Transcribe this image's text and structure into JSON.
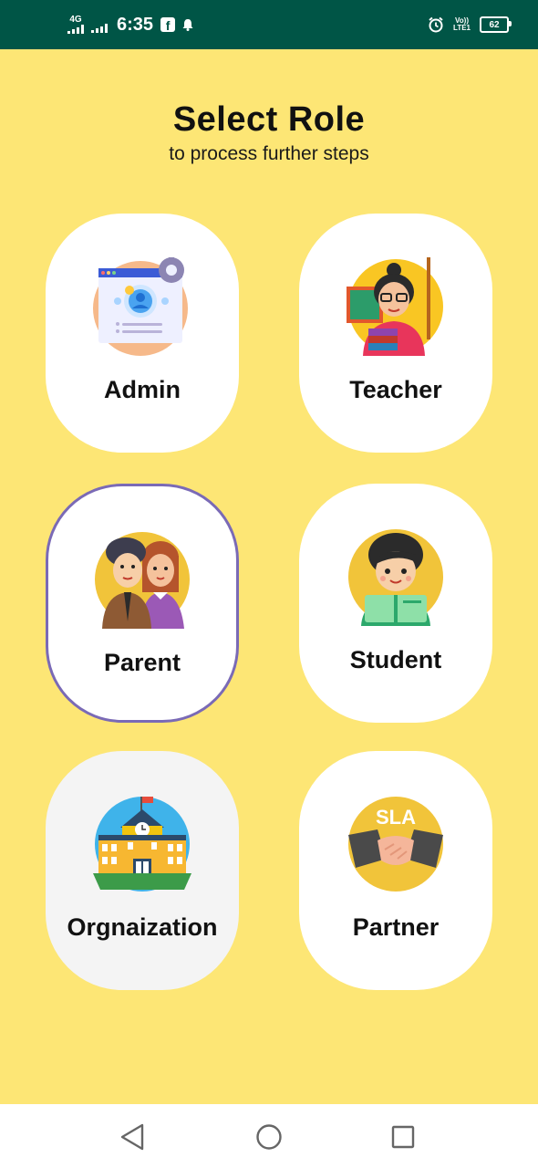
{
  "status_bar": {
    "network": "4G",
    "time": "6:35",
    "volte_top": "Vo))",
    "volte_bottom": "LTE1",
    "battery": "62",
    "icons": [
      "signal-icon",
      "signal-icon",
      "facebook-icon",
      "notification-bell-icon",
      "alarm-icon",
      "volte-icon",
      "battery-icon"
    ]
  },
  "header": {
    "title": "Select Role",
    "subtitle": "to process further steps"
  },
  "roles": [
    {
      "label": "Admin",
      "icon": "admin-profile-icon"
    },
    {
      "label": "Teacher",
      "icon": "teacher-icon"
    },
    {
      "label": "Parent",
      "icon": "parents-icon",
      "selected": true
    },
    {
      "label": "Student",
      "icon": "student-icon"
    },
    {
      "label": "Orgnaization",
      "icon": "school-building-icon"
    },
    {
      "label": "Partner",
      "icon": "handshake-icon",
      "badge": "SLA"
    }
  ],
  "nav": {
    "icons": [
      "back-triangle-icon",
      "home-circle-icon",
      "recents-square-icon"
    ]
  },
  "colors": {
    "background": "#fde675",
    "status_bar": "#005546",
    "selected_border": "#7a6ab6",
    "card": "#ffffff"
  }
}
